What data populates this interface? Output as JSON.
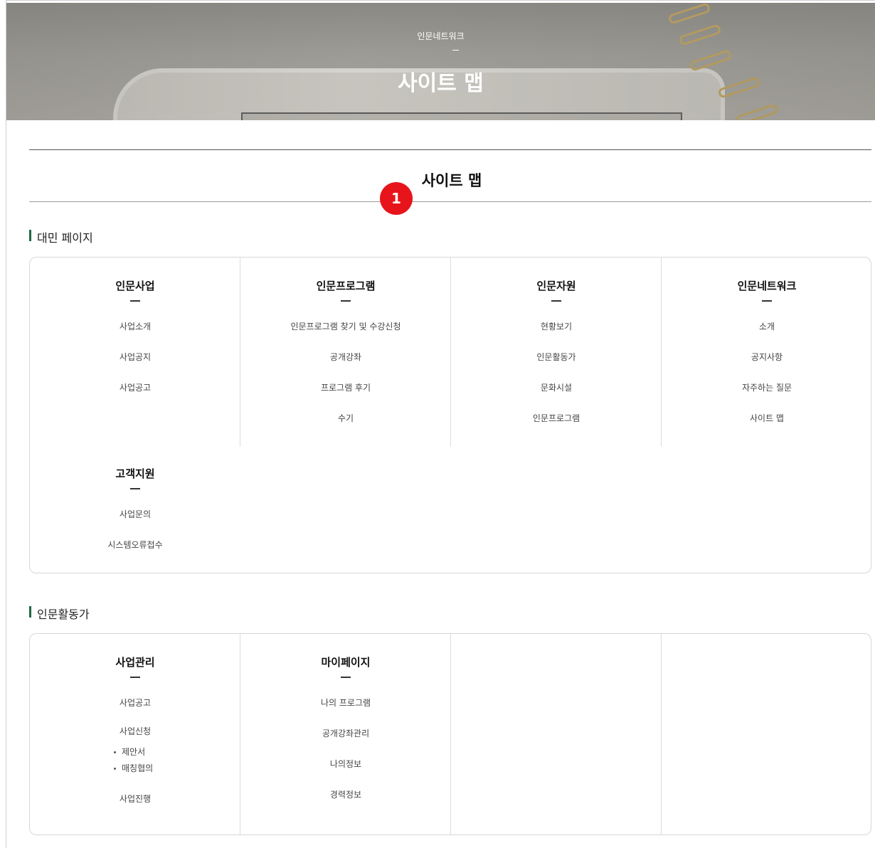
{
  "hero": {
    "subtitle": "인문네트워크",
    "title": "사이트 맵"
  },
  "page": {
    "title": "사이트 맵",
    "badge": "1"
  },
  "sections": [
    {
      "heading": "대민 페이지",
      "columns": [
        {
          "title": "인문사업",
          "items": [
            "사업소개",
            "사업공지",
            "사업공고"
          ]
        },
        {
          "title": "인문프로그램",
          "items": [
            "인문프로그램 찾기 및 수강신청",
            "공개강좌",
            "프로그램 후기",
            "수기"
          ]
        },
        {
          "title": "인문자원",
          "items": [
            "현황보기",
            "인문활동가",
            "문화시설",
            "인문프로그램"
          ]
        },
        {
          "title": "인문네트워크",
          "items": [
            "소개",
            "공지사항",
            "자주하는 질문",
            "사이트 맵"
          ]
        },
        {
          "title": "고객지원",
          "items": [
            "사업문의",
            "시스템오류접수"
          ]
        }
      ]
    },
    {
      "heading": "인문활동가",
      "columns": [
        {
          "title": "사업관리",
          "items": [
            "사업공고",
            "사업신청"
          ],
          "sub_items": [
            "제안서",
            "매칭협의"
          ],
          "items_after": [
            "사업진행"
          ]
        },
        {
          "title": "마이페이지",
          "items": [
            "나의 프로그램",
            "공개강좌관리",
            "나의정보",
            "경력정보"
          ]
        }
      ]
    }
  ]
}
